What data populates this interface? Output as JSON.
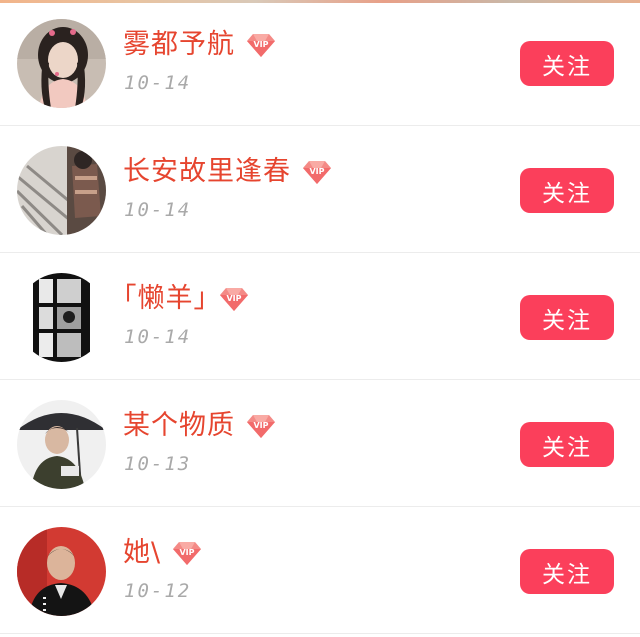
{
  "follow_list": {
    "items": [
      {
        "name": "雾都予航",
        "date": "10-14",
        "badge": "VIP",
        "button_label": "关注"
      },
      {
        "name": "长安故里逢春",
        "date": "10-14",
        "badge": "VIP",
        "button_label": "关注"
      },
      {
        "name": "｢懒羊｣",
        "date": "10-14",
        "badge": "VIP",
        "button_label": "关注"
      },
      {
        "name": "某个物质",
        "date": "10-13",
        "badge": "VIP",
        "button_label": "关注"
      },
      {
        "name": "她\\",
        "date": "10-12",
        "badge": "VIP",
        "button_label": "关注"
      }
    ]
  },
  "colors": {
    "name_text": "#e6452f",
    "date_text": "#a9a9a9",
    "follow_button_bg": "#fb3f5b",
    "follow_button_text": "#ffffff",
    "vip_badge": "#f26b6b",
    "divider": "#ececec"
  }
}
